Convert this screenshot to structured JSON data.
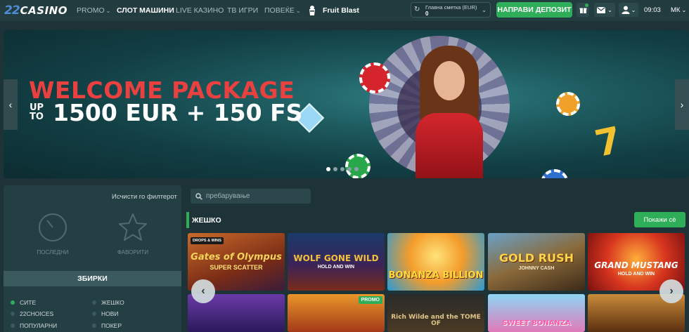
{
  "header": {
    "logo_number": "22",
    "logo_word": "CASINO",
    "nav": [
      {
        "label": "PROMO",
        "has_dropdown": true
      },
      {
        "label": "СЛОТ МАШИНИ",
        "active": true
      },
      {
        "label": "LIVE КАЗИНО"
      },
      {
        "label": "ТВ ИГРИ"
      },
      {
        "label": "ПОВЕЌЕ",
        "has_dropdown": true
      }
    ],
    "featured_game": "Fruit Blast",
    "account": {
      "label": "Главна сметка (EUR)",
      "value": "0"
    },
    "deposit_label": "НАПРАВИ ДЕПОЗИТ",
    "time": "09:03",
    "language": "МК"
  },
  "banner": {
    "title": "WELCOME PACKAGE",
    "upto_line1": "UP",
    "upto_line2": "TO",
    "amount": "1500 EUR + 150 FS",
    "slides": 5,
    "active_slide": 1
  },
  "filters": {
    "clear_label": "Исчисти го филтерот",
    "recent_label": "ПОСЛЕДНИ",
    "favorites_label": "ФАВОРИТИ",
    "collections_title": "ЗБИРКИ",
    "collections": [
      {
        "label": "СИТЕ",
        "selected": true
      },
      {
        "label": "ЖЕШКО"
      },
      {
        "label": "22CHOICES"
      },
      {
        "label": "НОВИ"
      },
      {
        "label": "ПОПУЛАРНИ"
      },
      {
        "label": "ПОКЕР"
      }
    ]
  },
  "games_section": {
    "search_placeholder": "пребарување",
    "title": "ЖЕШКО",
    "show_all": "Покажи сè",
    "row1": [
      {
        "title": "Gates of Olympus",
        "subtitle": "SUPER SCATTER",
        "tag": "DROPS & WINS"
      },
      {
        "title": "WOLF GONE WILD",
        "subtitle": "HOLD AND WIN"
      },
      {
        "title": "BONANZA BILLION",
        "subtitle": ""
      },
      {
        "title": "GOLD RUSH",
        "subtitle": "JOHNNY CASH"
      },
      {
        "title": "GRAND MUSTANG",
        "subtitle": "HOLD AND WIN"
      }
    ],
    "row2": [
      {
        "title": "",
        "subtitle": ""
      },
      {
        "title": "",
        "subtitle": "",
        "promo": "PROMO"
      },
      {
        "title": "Rich Wilde and the TOME OF",
        "subtitle": ""
      },
      {
        "title": "SWEET BONANZA",
        "subtitle": ""
      },
      {
        "title": "",
        "subtitle": ""
      }
    ]
  }
}
